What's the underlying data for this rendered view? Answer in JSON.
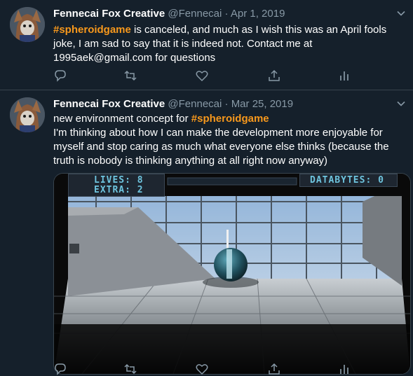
{
  "tweets": [
    {
      "author": "Fennecai Fox Creative",
      "handle": "@Fennecai",
      "separator": "·",
      "date": "Apr 1, 2019",
      "hashtag": "#spheroidgame",
      "text": " is canceled, and much as I wish this was an April fools joke, I am sad to say that it is indeed not. Contact me at 1995aek@gmail.com for questions"
    },
    {
      "author": "Fennecai Fox Creative",
      "handle": "@Fennecai",
      "separator": "·",
      "date": "Mar 25, 2019",
      "text_before": "new environment concept for ",
      "hashtag": "#spheroidgame",
      "text_after": "I'm thinking about  how I can make the development more enjoyable for myself and stop caring as much what everyone else thinks (because the truth is nobody is thinking anything at all right now anyway)",
      "game_hud": {
        "lives": "LIVES: 8",
        "extra": "EXTRA: 2",
        "databytes": "DATABYTES: 0"
      }
    }
  ],
  "icons": [
    "reply-icon",
    "retweet-icon",
    "like-icon",
    "share-icon",
    "analytics-icon",
    "chevron-down-icon"
  ],
  "colors": {
    "background": "#15202b",
    "hashtag": "#f7981c",
    "muted": "#8899a6",
    "border": "#38444d",
    "hud_text": "#6ec4de"
  }
}
